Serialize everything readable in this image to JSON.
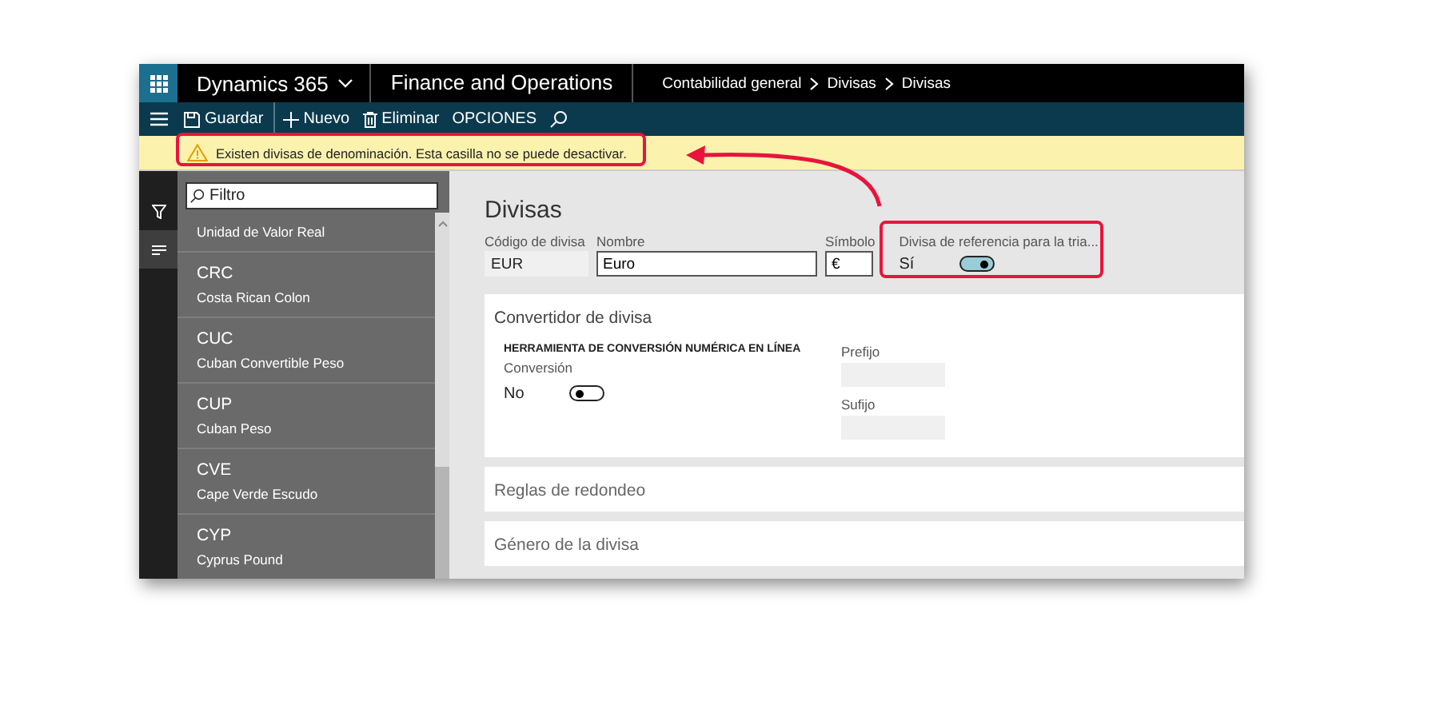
{
  "header": {
    "product": "Dynamics 365",
    "module": "Finance and Operations",
    "breadcrumb": [
      "Contabilidad general",
      "Divisas",
      "Divisas"
    ]
  },
  "toolbar": [
    {
      "kind": "save",
      "label": "Guardar"
    },
    {
      "kind": "new",
      "label": "Nuevo"
    },
    {
      "kind": "delete",
      "label": "Eliminar"
    },
    {
      "kind": "text",
      "label": "OPCIONES"
    },
    {
      "kind": "search"
    }
  ],
  "warning": "Existen divisas de denominación. Esta casilla no se puede desactivar.",
  "rail": [
    {
      "kind": "filter",
      "selected": false
    },
    {
      "kind": "list",
      "selected": true
    }
  ],
  "list": {
    "placeholder": "Filtro",
    "items": [
      {
        "name": "Unidad de Valor Real"
      },
      {
        "code": "CRC",
        "name": "Costa Rican Colon"
      },
      {
        "code": "CUC",
        "name": "Cuban Convertible Peso"
      },
      {
        "code": "CUP",
        "name": "Cuban Peso"
      },
      {
        "code": "CVE",
        "name": "Cape Verde Escudo"
      },
      {
        "code": "CYP",
        "name": "Cyprus Pound"
      }
    ]
  },
  "form": {
    "title": "Divisas",
    "fields": [
      {
        "kind": "readonly",
        "label": "Código de divisa",
        "value": "EUR"
      },
      {
        "kind": "input",
        "label": "Nombre",
        "value": "Euro"
      },
      {
        "kind": "input",
        "label": "Símbolo",
        "value": "€"
      },
      {
        "kind": "toggle",
        "label": "Divisa de referencia para la tria...",
        "value": "Sí",
        "on": true
      }
    ]
  },
  "sections": [
    {
      "title": "Convertidor de divisa",
      "expanded": true,
      "group": "HERRAMIENTA DE CONVERSIÓN NUMÉRICA EN LÍNEA",
      "toggle": {
        "label": "Conversión",
        "value": "No",
        "on": false
      },
      "fields": [
        {
          "label": "Prefijo"
        },
        {
          "label": "Sufijo"
        }
      ]
    },
    {
      "title": "Reglas de redondeo",
      "expanded": false
    },
    {
      "title": "Género de la divisa",
      "expanded": false
    }
  ]
}
